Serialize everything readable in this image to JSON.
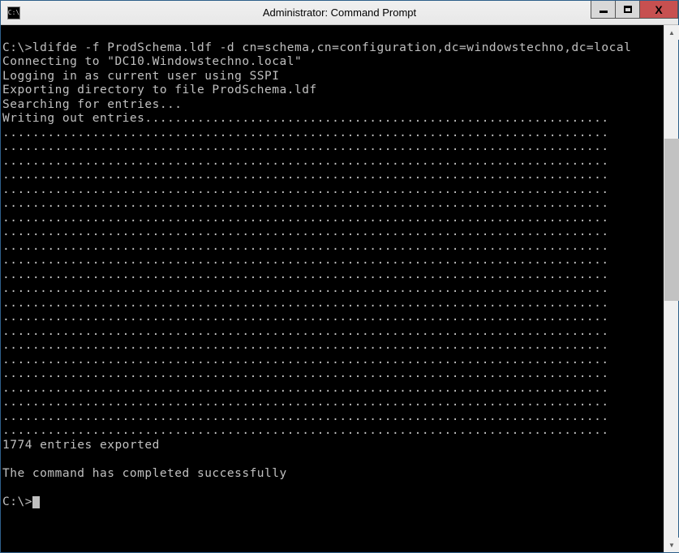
{
  "window": {
    "title": "Administrator: Command Prompt",
    "icon_label": "cmd-icon"
  },
  "terminal": {
    "prompt1": "C:\\>",
    "command": "ldifde -f ProdSchema.ldf -d cn=schema,cn=configuration,dc=windowstechno,dc=local",
    "line_connecting": "Connecting to \"DC10.Windowstechno.local\"",
    "line_logging": "Logging in as current user using SSPI",
    "line_exporting": "Exporting directory to file ProdSchema.ldf",
    "line_searching": "Searching for entries...",
    "line_writing_prefix": "Writing out entries",
    "dot_rows_count": 22,
    "entries_exported": "1774 entries exported",
    "completed": "The command has completed successfully",
    "prompt2": "C:\\>"
  }
}
